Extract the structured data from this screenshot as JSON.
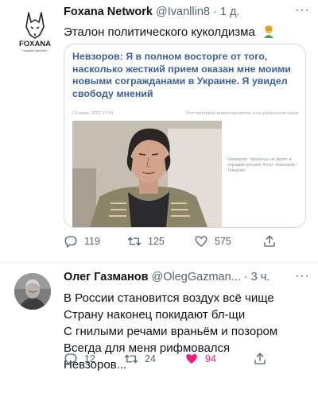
{
  "tweet1": {
    "author_name": "Foxana Network",
    "handle": "@Ivanllin8",
    "separator": "·",
    "time": "1 д.",
    "text": "Эталон политического куколдизма",
    "emoji_icon": "mage-emoji",
    "avatar": {
      "logo_text": "FOXANA",
      "sub_text": "паршивая аналитика"
    },
    "card": {
      "headline": "Невзоров: Я в полном восторге от того, насколько жесткий прием оказан мне моими новыми согражданами в Украине. Я увидел свободу мнений",
      "meta_left": "|  5 июня, 2022 17:30",
      "meta_right": "Этот материал можно прочитать и на украинском языке",
      "caption": "Невзоров: Украинцы не верят в хороших русских  Фото: Невзоров / Telegram"
    },
    "actions": {
      "replies": "119",
      "retweets": "125",
      "likes": "575"
    }
  },
  "tweet2": {
    "author_name": "Олег Газманов",
    "handle": "@OlegGazman...",
    "separator": "·",
    "time": "3 ч.",
    "lines": [
      "В России становится воздух всё чище",
      "Страну наконец покидают бл-щи",
      "С гнилыми речами враньём и позором",
      "Всегда для меня рифмовался",
      "Невзоров..."
    ],
    "actions": {
      "replies": "12",
      "retweets": "24",
      "likes": "94"
    }
  },
  "colors": {
    "like_active": "#f91880",
    "headline": "#3f5f94",
    "muted": "#536471"
  }
}
